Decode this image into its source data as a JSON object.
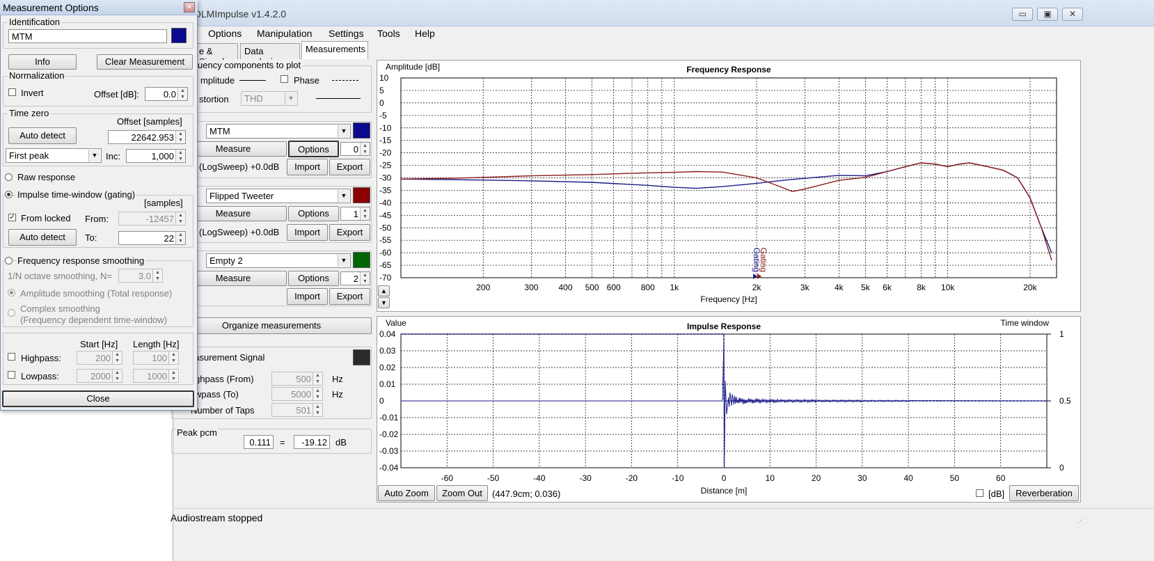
{
  "window": {
    "title": "OLMImpulse  v1.4.2.0",
    "minimize": "▭",
    "maximize": "▣",
    "close": "✕"
  },
  "menu": [
    "Options",
    "Manipulation",
    "Settings",
    "Tools",
    "Help"
  ],
  "tabs": [
    "e & Signal",
    "Data analysis",
    "Measurements"
  ],
  "components": {
    "label": "uency components to plot",
    "amplitude": "mplitude",
    "phase": "Phase",
    "distortion": "stortion",
    "distortion_value": "THD"
  },
  "measurements": [
    {
      "name": "MTM",
      "color": "#0a0a8c",
      "measure": "Measure",
      "options": "Options",
      "index": "0",
      "info": "(LogSweep) +0.0dB",
      "import": "Import",
      "export": "Export"
    },
    {
      "name": "Flipped Tweeter",
      "color": "#8b0000",
      "measure": "Measure",
      "options": "Options",
      "index": "1",
      "info": "(LogSweep) +0.0dB",
      "import": "Import",
      "export": "Export"
    },
    {
      "name": "Empty 2",
      "color": "#006400",
      "measure": "Measure",
      "options": "Options",
      "index": "2",
      "info": "",
      "import": "Import",
      "export": "Export"
    }
  ],
  "organize": "Organize measurements",
  "signal": {
    "label": "easurement Signal",
    "color": "#2b2b2b",
    "highpass_label": "ghpass (From)",
    "highpass_value": "500",
    "lowpass_label": "wpass (To)",
    "lowpass_value": "5000",
    "unit": "Hz",
    "taps_label": "Number of Taps",
    "taps_value": "501"
  },
  "peak": {
    "label": "Peak pcm",
    "value": "0.111",
    "eq": "=",
    "db_value": "-19.12",
    "unit": "dB"
  },
  "status": "Audiostream stopped",
  "freq_chart": {
    "title": "Frequency Response",
    "ylabel": "Amplitude [dB]",
    "xlabel": "Frequency [Hz]",
    "yticks": [
      "10",
      "5",
      "0",
      "-5",
      "-10",
      "-15",
      "-20",
      "-25",
      "-30",
      "-35",
      "-40",
      "-45",
      "-50",
      "-55",
      "-60",
      "-65",
      "-70"
    ],
    "xticks": [
      "200",
      "300",
      "400",
      "500",
      "600",
      "800",
      "1k",
      "2k",
      "3k",
      "4k",
      "5k",
      "6k",
      "8k",
      "10k",
      "20k"
    ],
    "gating_label": "Gating"
  },
  "imp_chart": {
    "title": "Impulse Response",
    "ylabel": "Value",
    "y2label": "Time window",
    "xlabel": "Distance [m]",
    "yticks": [
      "0.04",
      "0.03",
      "0.02",
      "0.01",
      "0",
      "-0.01",
      "-0.02",
      "-0.03",
      "-0.04"
    ],
    "y2ticks": [
      "1",
      "0.5",
      "0"
    ],
    "xticks": [
      "-60",
      "-50",
      "-40",
      "-30",
      "-20",
      "-10",
      "0",
      "10",
      "20",
      "30",
      "40",
      "50",
      "60"
    ],
    "auto_zoom": "Auto Zoom",
    "zoom_out": "Zoom Out",
    "cursor": "(447.9cm; 0.036)",
    "db_label": "[dB]",
    "reverberation": "Reverberation"
  },
  "chart_data": [
    {
      "type": "line",
      "title": "Frequency Response",
      "xlabel": "Frequency [Hz]",
      "ylabel": "Amplitude [dB]",
      "xscale": "log",
      "xlim": [
        100,
        25000
      ],
      "ylim": [
        -70,
        10
      ],
      "grid": true,
      "series": [
        {
          "name": "MTM",
          "color": "#1a1a8a",
          "x": [
            100,
            150,
            200,
            300,
            500,
            800,
            1000,
            1200,
            1500,
            2000,
            2500,
            3000,
            4000,
            5000,
            6000,
            7000,
            8000,
            9000,
            10000,
            11000,
            12000,
            14000,
            16000,
            18000,
            20000,
            22000,
            24000
          ],
          "y": [
            -30.5,
            -30.7,
            -30.9,
            -31.2,
            -31.8,
            -33,
            -33.8,
            -34.2,
            -33.5,
            -32.2,
            -31,
            -30.2,
            -29,
            -29.2,
            -27.5,
            -25.5,
            -24,
            -24.5,
            -25.5,
            -24.5,
            -24,
            -25.5,
            -27,
            -30,
            -38,
            -50,
            -60
          ]
        },
        {
          "name": "Flipped Tweeter",
          "color": "#8b1a1a",
          "x": [
            100,
            150,
            200,
            300,
            500,
            800,
            1000,
            1200,
            1500,
            2000,
            2500,
            2700,
            3000,
            4000,
            5000,
            6000,
            7000,
            8000,
            9000,
            10000,
            11000,
            12000,
            14000,
            16000,
            18000,
            20000,
            22000,
            24000
          ],
          "y": [
            -30.5,
            -30.2,
            -29.8,
            -29.2,
            -28.7,
            -28,
            -27.8,
            -27.5,
            -27.7,
            -30,
            -34,
            -35.5,
            -34.5,
            -31,
            -29.8,
            -27.5,
            -25.5,
            -24,
            -24.5,
            -25.5,
            -24.5,
            -24,
            -25.5,
            -27,
            -30,
            -38,
            -50,
            -63
          ]
        }
      ],
      "marker": {
        "label": "Gating",
        "x": 2000
      }
    },
    {
      "type": "line",
      "title": "Impulse Response",
      "xlabel": "Distance [m]",
      "ylabel": "Value",
      "y2label": "Time window",
      "xlim": [
        -70,
        70
      ],
      "ylim": [
        -0.04,
        0.04
      ],
      "y2lim": [
        0,
        1
      ],
      "grid": true,
      "series": [
        {
          "name": "MTM",
          "color": "#1a1a8a",
          "x": [
            -70,
            -0.3,
            0,
            0.1,
            0.3,
            0.6,
            1,
            1.5,
            2,
            3,
            5,
            8,
            12,
            20,
            30,
            40,
            70
          ],
          "y": [
            0,
            0,
            0.036,
            -0.04,
            0.012,
            -0.008,
            0.005,
            -0.004,
            0.003,
            -0.002,
            0.0015,
            -0.001,
            0.0008,
            -0.0006,
            0.0004,
            0.0002,
            0
          ]
        },
        {
          "name": "Time window",
          "color": "#1a1a8a",
          "x": [
            -70,
            0,
            0,
            70
          ],
          "y2": [
            1,
            1,
            0.5,
            0.5
          ]
        }
      ]
    }
  ],
  "dialog": {
    "title": "Measurement Options",
    "identification": "Identification",
    "name_value": "MTM",
    "color": "#0a0a8c",
    "info": "Info",
    "clear": "Clear Measurement",
    "normalization": "Normalization",
    "invert": "Invert",
    "offset_db_label": "Offset [dB]:",
    "offset_db_value": "0.0",
    "time_zero": "Time zero",
    "offset_samples_label": "Offset [samples]",
    "auto_detect": "Auto detect",
    "offset_samples_value": "22642.953",
    "peak_mode": "First peak",
    "inc_label": "Inc:",
    "inc_value": "1,000",
    "raw_response": "Raw response",
    "impulse_window": "Impulse time-window (gating)",
    "samples_label": "[samples]",
    "from_locked": "From locked",
    "from_label": "From:",
    "from_value": "-12457",
    "auto_detect2": "Auto detect",
    "to_label": "To:",
    "to_value": "22",
    "smoothing": "Frequency response smoothing",
    "octave_label": "1/N octave smoothing, N=",
    "octave_value": "3.0",
    "amp_smoothing": "Amplitude smoothing (Total response)",
    "complex_smoothing": "Complex smoothing",
    "complex_sub": "(Frequency dependent time-window)",
    "start_label": "Start [Hz]",
    "length_label": "Length [Hz]",
    "highpass": "Highpass:",
    "highpass_start": "200",
    "highpass_length": "100",
    "lowpass": "Lowpass:",
    "lowpass_start": "2000",
    "lowpass_length": "1000",
    "close": "Close"
  }
}
